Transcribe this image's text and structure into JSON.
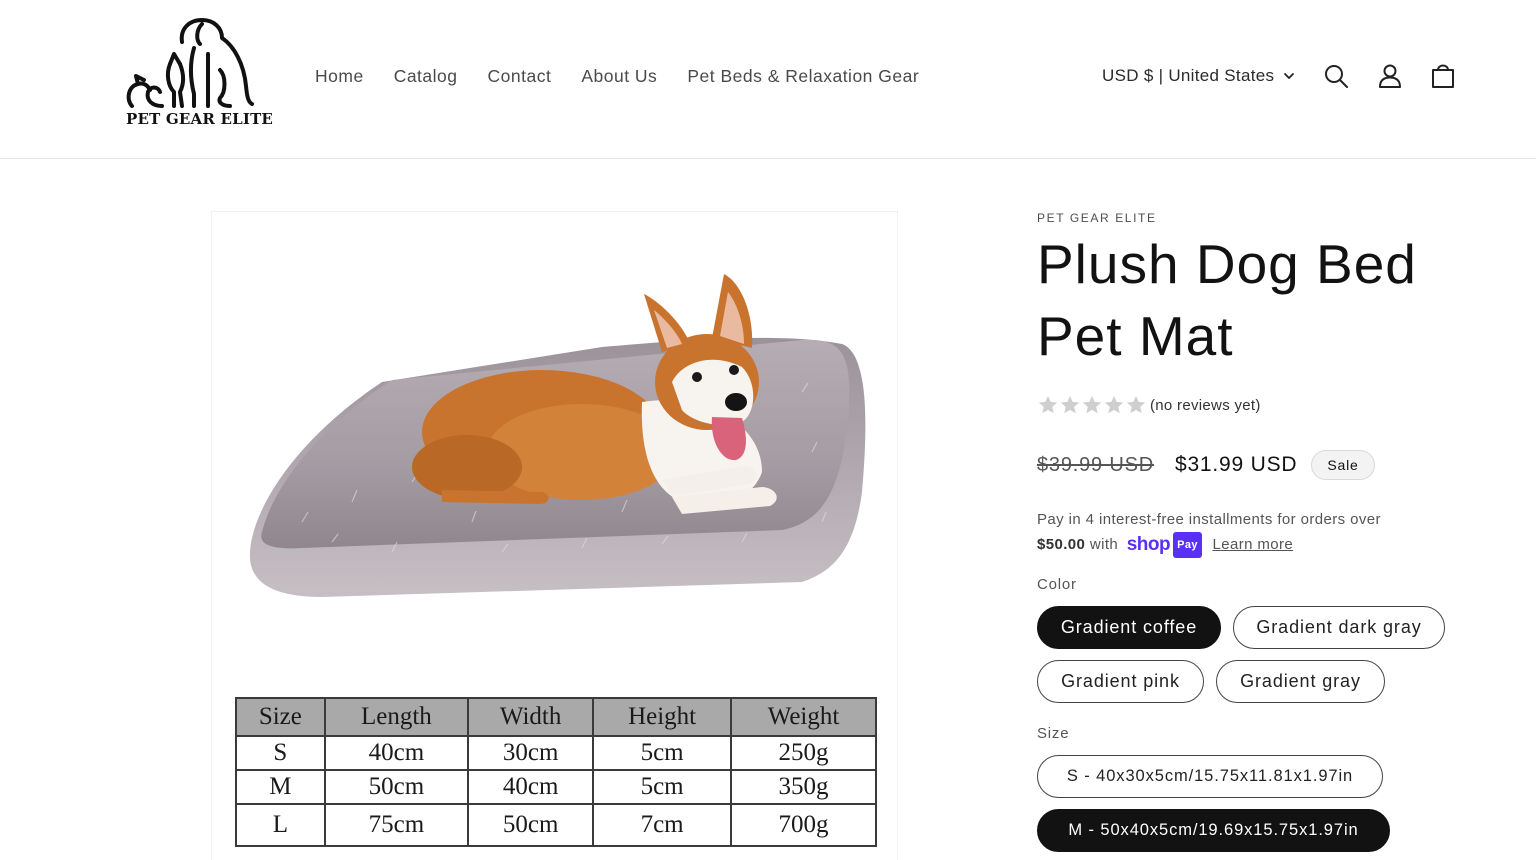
{
  "header": {
    "logo_text": "PET GEAR ELITE",
    "nav": [
      "Home",
      "Catalog",
      "Contact",
      "About Us",
      "Pet Beds & Relaxation Gear"
    ],
    "currency": "USD $ | United States"
  },
  "size_chart": {
    "headers": [
      "Size",
      "Length",
      "Width",
      "Height",
      "Weight"
    ],
    "rows": [
      [
        "S",
        "40cm",
        "30cm",
        "5cm",
        "250g"
      ],
      [
        "M",
        "50cm",
        "40cm",
        "5cm",
        "350g"
      ],
      [
        "L",
        "75cm",
        "50cm",
        "7cm",
        "700g"
      ]
    ]
  },
  "product": {
    "vendor": "PET GEAR ELITE",
    "title": "Plush Dog Bed Pet Mat",
    "rating": 0,
    "reviews_text": "(no reviews yet)",
    "old_price": "$39.99 USD",
    "price": "$31.99 USD",
    "sale_badge": "Sale",
    "installments": {
      "text_before": "Pay in 4 interest-free installments for orders over",
      "threshold": "$50.00",
      "with": "with",
      "shop_word": "shop",
      "pay_word": "Pay",
      "learn_more": "Learn more"
    },
    "color_label": "Color",
    "colors": [
      "Gradient coffee",
      "Gradient dark gray",
      "Gradient pink",
      "Gradient gray"
    ],
    "selected_color": "Gradient coffee",
    "size_label": "Size",
    "sizes": [
      "S - 40x30x5cm/15.75x11.81x1.97in",
      "M - 50x40x5cm/19.69x15.75x1.97in"
    ],
    "selected_size": "M - 50x40x5cm/19.69x15.75x1.97in"
  },
  "colors": {
    "shop_pay": "#5a31f4",
    "selected_pill": "#121212",
    "star_empty": "#cfcfcf"
  }
}
